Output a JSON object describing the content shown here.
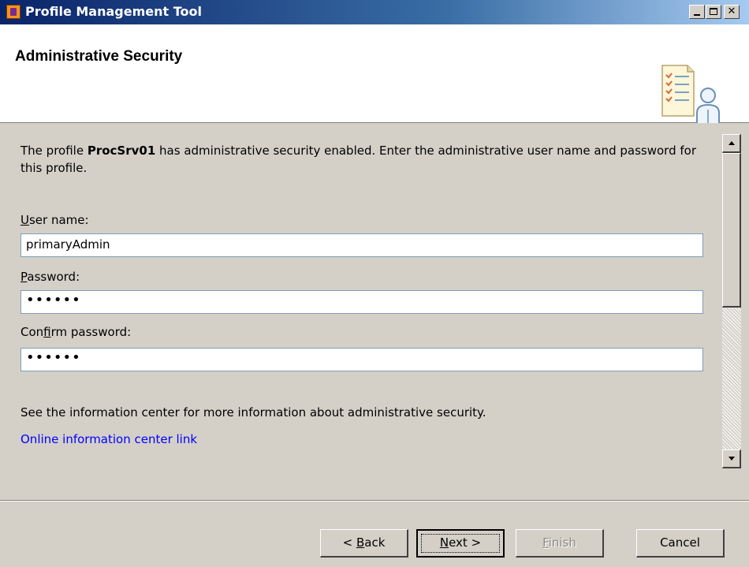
{
  "window": {
    "title": "Profile Management Tool"
  },
  "header": {
    "title": "Administrative Security"
  },
  "main": {
    "intro_prefix": "The profile ",
    "profile_name": "ProcSrv01",
    "intro_suffix": " has administrative security enabled.  Enter the administrative user name and password for this profile.",
    "user_name": {
      "label_access": "U",
      "label_rest": "ser name:",
      "value": "primaryAdmin"
    },
    "password": {
      "label_access": "P",
      "label_rest": "assword:",
      "value": "••••••"
    },
    "confirm_password": {
      "label_pre": "Con",
      "label_access": "f",
      "label_rest": "irm password:",
      "value": "••••••"
    },
    "info_text": "See the information center for more information about administrative security.",
    "info_link": "Online information center link"
  },
  "buttons": {
    "back": {
      "pre": "< ",
      "access": "B",
      "rest": "ack"
    },
    "next": {
      "access": "N",
      "rest": "ext >"
    },
    "finish": {
      "access": "F",
      "rest": "inish"
    },
    "cancel": "Cancel"
  },
  "colors": {
    "titlebar_start": "#0a246a",
    "titlebar_end": "#a6caf0",
    "link": "#0000ff",
    "dialog_bg": "#d4d0c8"
  }
}
